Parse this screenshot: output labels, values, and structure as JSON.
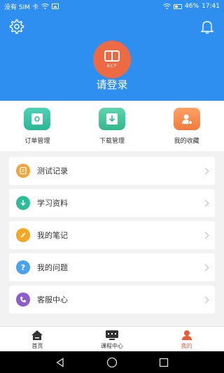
{
  "status_bar": {
    "carrier": "没有 SIM 卡",
    "battery": "46%",
    "time": "17:41"
  },
  "header": {
    "login_text": "请登录",
    "avatar_text": "ACP"
  },
  "shortcuts": [
    {
      "label": "订单管理",
      "icon": "order-icon",
      "color": "#2ab795"
    },
    {
      "label": "下载管理",
      "icon": "download-icon",
      "color": "#30b98a"
    },
    {
      "label": "我的收藏",
      "icon": "favorite-icon",
      "color": "#f27b3c"
    }
  ],
  "menu": [
    {
      "label": "测试记录",
      "icon": "test-record-icon",
      "color": "#f2a33a"
    },
    {
      "label": "学习资料",
      "icon": "study-material-icon",
      "color": "#2dbb98"
    },
    {
      "label": "我的笔记",
      "icon": "note-icon",
      "color": "#f5a623"
    },
    {
      "label": "我的问题",
      "icon": "question-icon",
      "color": "#4aa3ee"
    },
    {
      "label": "客服中心",
      "icon": "customer-service-icon",
      "color": "#8e5ccc"
    }
  ],
  "tabbar": [
    {
      "label": "首页",
      "icon": "home-icon"
    },
    {
      "label": "课程中心",
      "icon": "course-icon"
    },
    {
      "label": "我的",
      "icon": "profile-icon",
      "active": true
    }
  ],
  "colors": {
    "primary": "#2f8ff0",
    "accent": "#e85a39"
  }
}
